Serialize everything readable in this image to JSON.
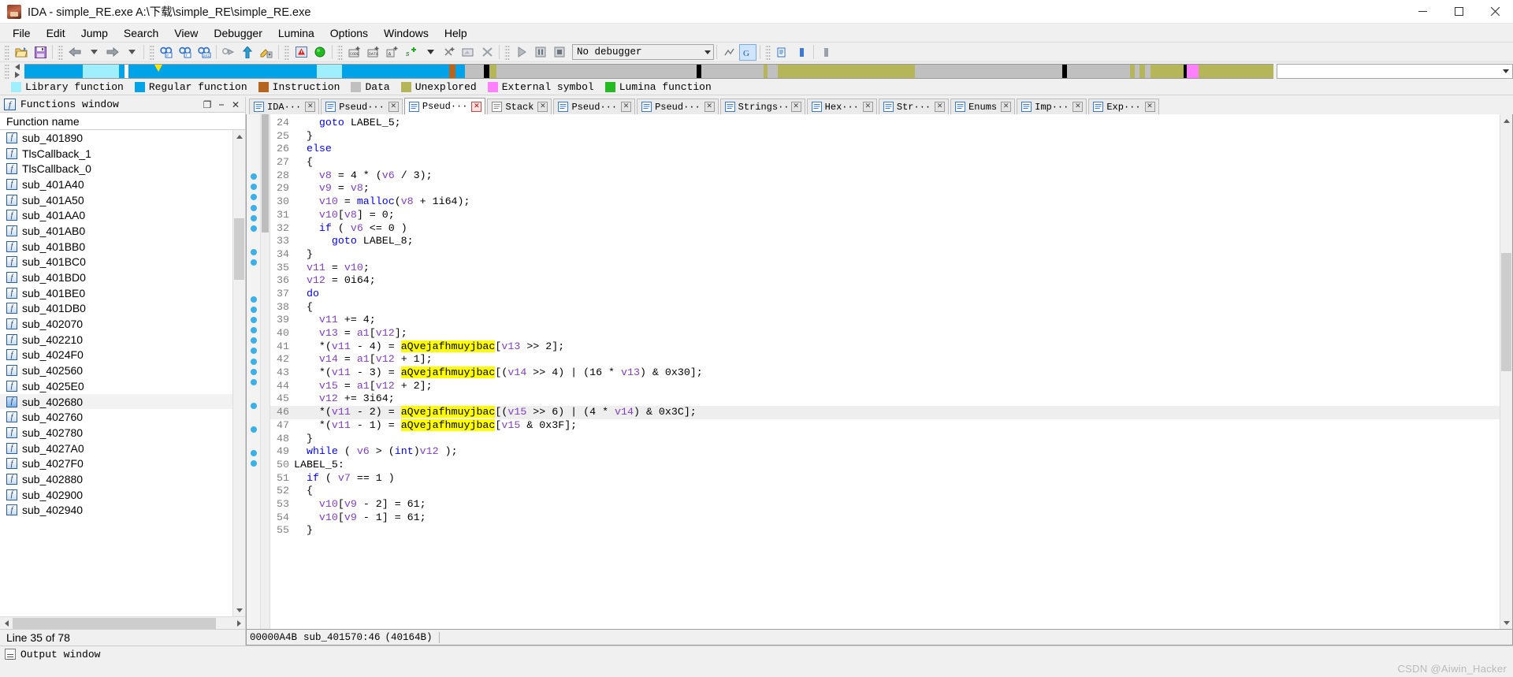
{
  "window": {
    "title": "IDA - simple_RE.exe A:\\下载\\simple_RE\\simple_RE.exe",
    "app_icon": "ida-logo-icon",
    "minimize_label": "–",
    "maximize_label": "☐",
    "close_label": "✕"
  },
  "menu": {
    "items": [
      {
        "label": "File"
      },
      {
        "label": "Edit"
      },
      {
        "label": "Jump"
      },
      {
        "label": "Search"
      },
      {
        "label": "View"
      },
      {
        "label": "Debugger"
      },
      {
        "label": "Lumina"
      },
      {
        "label": "Options"
      },
      {
        "label": "Windows"
      },
      {
        "label": "Help"
      }
    ]
  },
  "toolbar": {
    "debugger_combo_value": "No debugger",
    "buttons": [
      {
        "name": "open-file-icon"
      },
      {
        "name": "save-icon"
      },
      {
        "name": "back-arrow-icon"
      },
      {
        "name": "back-dropdown-icon"
      },
      {
        "name": "forward-arrow-icon"
      },
      {
        "name": "forward-dropdown-icon"
      },
      {
        "name": "search-hex-icon"
      },
      {
        "name": "search-text-icon"
      },
      {
        "name": "search-sequence-icon"
      },
      {
        "name": "jump-icon"
      },
      {
        "name": "up-arrow-icon"
      },
      {
        "name": "edit-function-icon"
      },
      {
        "name": "warning-icon"
      },
      {
        "name": "green-circle-icon"
      },
      {
        "name": "make-code-icon"
      },
      {
        "name": "make-data-icon"
      },
      {
        "name": "make-ascii-icon"
      },
      {
        "name": "make-struct-icon"
      },
      {
        "name": "make-struct-dropdown-icon"
      },
      {
        "name": "undefine-icon"
      },
      {
        "name": "rename-icon"
      },
      {
        "name": "delete-icon"
      },
      {
        "name": "run-icon"
      },
      {
        "name": "pause-icon"
      },
      {
        "name": "stop-icon"
      }
    ],
    "right_buttons": [
      {
        "name": "graph-overview-icon"
      },
      {
        "name": "lumina-icon"
      },
      {
        "name": "notepad-icon"
      },
      {
        "name": "hex-strip-icon"
      },
      {
        "name": "misc-icon"
      }
    ]
  },
  "navband": {
    "cursor_position_pct": 10.4,
    "segments": [
      {
        "color": "#00a2e8",
        "width_pct": 4.7
      },
      {
        "color": "#a0efff",
        "width_pct": 2.9
      },
      {
        "color": "#00a2e8",
        "width_pct": 0.4
      },
      {
        "color": "#ffffff",
        "width_pct": 0.3
      },
      {
        "color": "#00a2e8",
        "width_pct": 15.1
      },
      {
        "color": "#a0efff",
        "width_pct": 2.0
      },
      {
        "color": "#00a2e8",
        "width_pct": 8.6
      },
      {
        "color": "#b5651d",
        "width_pct": 0.5
      },
      {
        "color": "#00a2e8",
        "width_pct": 0.8
      },
      {
        "color": "#c0c0c0",
        "width_pct": 1.5
      },
      {
        "color": "#000000",
        "width_pct": 0.4
      },
      {
        "color": "#b5b55a",
        "width_pct": 0.6
      },
      {
        "color": "#c0c0c0",
        "width_pct": 16.0
      },
      {
        "color": "#000000",
        "width_pct": 0.4
      },
      {
        "color": "#c0c0c0",
        "width_pct": 5.0
      },
      {
        "color": "#b5b55a",
        "width_pct": 0.3
      },
      {
        "color": "#c0c0c0",
        "width_pct": 0.8
      },
      {
        "color": "#b5b55a",
        "width_pct": 11.0
      },
      {
        "color": "#c0c0c0",
        "width_pct": 11.8
      },
      {
        "color": "#000000",
        "width_pct": 0.4
      },
      {
        "color": "#c0c0c0",
        "width_pct": 5.0
      },
      {
        "color": "#b5b55a",
        "width_pct": 0.4
      },
      {
        "color": "#c0c0c0",
        "width_pct": 0.4
      },
      {
        "color": "#b5b55a",
        "width_pct": 0.4
      },
      {
        "color": "#c0c0c0",
        "width_pct": 0.5
      },
      {
        "color": "#b5b55a",
        "width_pct": 2.6
      },
      {
        "color": "#000000",
        "width_pct": 0.3
      },
      {
        "color": "#ff80ff",
        "width_pct": 0.9
      },
      {
        "color": "#b5b55a",
        "width_pct": 6.3
      },
      {
        "color": "#000000",
        "width_pct": 0.3
      },
      {
        "color": "#b5b55a",
        "width_pct": 6.2
      },
      {
        "color": "#000000",
        "width_pct": 16.0
      }
    ]
  },
  "legend": {
    "items": [
      {
        "label": "Library function",
        "color": "#a0efff"
      },
      {
        "label": "Regular function",
        "color": "#00a2e8"
      },
      {
        "label": "Instruction",
        "color": "#b5651d"
      },
      {
        "label": "Data",
        "color": "#c0c0c0"
      },
      {
        "label": "Unexplored",
        "color": "#b5b55a"
      },
      {
        "label": "External symbol",
        "color": "#ff80ff"
      },
      {
        "label": "Lumina function",
        "color": "#22bb22"
      }
    ]
  },
  "functions_window": {
    "title": "Functions window",
    "icon": "function-window-icon",
    "controls": [
      {
        "name": "restore-icon",
        "glyph": "❐"
      },
      {
        "name": "minimize-icon",
        "glyph": "⎯"
      },
      {
        "name": "close-icon",
        "glyph": "✕"
      }
    ],
    "column_header": "Function name",
    "rows": [
      {
        "name": "sub_401890"
      },
      {
        "name": "TlsCallback_1"
      },
      {
        "name": "TlsCallback_0"
      },
      {
        "name": "sub_401A40"
      },
      {
        "name": "sub_401A50"
      },
      {
        "name": "sub_401AA0"
      },
      {
        "name": "sub_401AB0"
      },
      {
        "name": "sub_401BB0"
      },
      {
        "name": "sub_401BC0"
      },
      {
        "name": "sub_401BD0"
      },
      {
        "name": "sub_401BE0"
      },
      {
        "name": "sub_401DB0"
      },
      {
        "name": "sub_402070"
      },
      {
        "name": "sub_402210"
      },
      {
        "name": "sub_4024F0"
      },
      {
        "name": "sub_402560"
      },
      {
        "name": "sub_4025E0"
      },
      {
        "name": "sub_402680",
        "selected": true
      },
      {
        "name": "sub_402760"
      },
      {
        "name": "sub_402780"
      },
      {
        "name": "sub_4027A0"
      },
      {
        "name": "sub_4027F0"
      },
      {
        "name": "sub_402880"
      },
      {
        "name": "sub_402900"
      },
      {
        "name": "sub_402940"
      }
    ],
    "status": "Line 35 of 78"
  },
  "tabs": [
    {
      "label": "IDA···",
      "icon": "ida-view-icon",
      "icon_color": "#3a7ad6",
      "active": false,
      "close": "✕"
    },
    {
      "label": "Pseud···",
      "icon": "pseudocode-icon",
      "icon_color": "#3a7ad6",
      "active": false,
      "close": "✕"
    },
    {
      "label": "Pseud···",
      "icon": "pseudocode-icon",
      "icon_color": "#3a7ad6",
      "active": true,
      "close": "✕"
    },
    {
      "label": "Stack",
      "icon": "stack-icon",
      "icon_color": "#888888",
      "active": false,
      "close": "✕"
    },
    {
      "label": "Pseud···",
      "icon": "pseudocode-icon",
      "icon_color": "#3a7ad6",
      "active": false,
      "close": "✕"
    },
    {
      "label": "Pseud···",
      "icon": "pseudocode-icon",
      "icon_color": "#3a7ad6",
      "active": false,
      "close": "✕"
    },
    {
      "label": "Strings···",
      "icon": "strings-icon",
      "icon_color": "#3a7ad6",
      "active": false,
      "close": "✕"
    },
    {
      "label": "Hex···",
      "icon": "hex-view-icon",
      "icon_color": "#3a7ad6",
      "active": false,
      "close": "✕"
    },
    {
      "label": "Str···",
      "icon": "structures-icon",
      "icon_color": "#3a7ad6",
      "active": false,
      "close": "✕"
    },
    {
      "label": "Enums",
      "icon": "enums-icon",
      "icon_color": "#3a7ad6",
      "active": false,
      "close": "✕"
    },
    {
      "label": "Imp···",
      "icon": "imports-icon",
      "icon_color": "#3a7ad6",
      "active": false,
      "close": "✕"
    },
    {
      "label": "Exp···",
      "icon": "exports-icon",
      "icon_color": "#3a7ad6",
      "active": false,
      "close": "✕"
    }
  ],
  "code": {
    "highlighted_identifier": "aQvejafhmuyjbac",
    "current_line": 46,
    "lines": [
      {
        "n": 24,
        "bm": false,
        "indent": 4,
        "html": "<span class=\"kw\">goto</span> <span class=\"ctext\">LABEL_5;</span>"
      },
      {
        "n": 25,
        "bm": false,
        "indent": 2,
        "html": "<span class=\"ctext\">}</span>"
      },
      {
        "n": 26,
        "bm": false,
        "indent": 2,
        "html": "<span class=\"kw\">else</span>"
      },
      {
        "n": 27,
        "bm": false,
        "indent": 2,
        "html": "<span class=\"ctext\">{</span>"
      },
      {
        "n": 28,
        "bm": true,
        "indent": 4,
        "html": "<span class=\"var\">v8</span> <span class=\"ctext\">= 4 * (</span><span class=\"var\">v6</span> <span class=\"ctext\">/ 3);</span>"
      },
      {
        "n": 29,
        "bm": true,
        "indent": 4,
        "html": "<span class=\"var\">v9</span> <span class=\"ctext\">= </span><span class=\"var\">v8</span><span class=\"ctext\">;</span>"
      },
      {
        "n": 30,
        "bm": true,
        "indent": 4,
        "html": "<span class=\"var\">v10</span> <span class=\"ctext\">= </span><span class=\"fn\">malloc</span><span class=\"ctext\">(</span><span class=\"var\">v8</span> <span class=\"ctext\">+ 1i64);</span>"
      },
      {
        "n": 31,
        "bm": true,
        "indent": 4,
        "html": "<span class=\"var\">v10</span><span class=\"ctext\">[</span><span class=\"var\">v8</span><span class=\"ctext\">] = 0;</span>"
      },
      {
        "n": 32,
        "bm": true,
        "indent": 4,
        "html": "<span class=\"kw\">if</span> <span class=\"ctext\">( </span><span class=\"var\">v6</span> <span class=\"ctext\">&lt;= 0 )</span>"
      },
      {
        "n": 33,
        "bm": true,
        "indent": 6,
        "html": "<span class=\"kw\">goto</span> <span class=\"ctext\">LABEL_8;</span>"
      },
      {
        "n": 34,
        "bm": false,
        "indent": 2,
        "html": "<span class=\"ctext\">}</span>"
      },
      {
        "n": 35,
        "bm": true,
        "indent": 2,
        "html": "<span class=\"var\">v11</span> <span class=\"ctext\">= </span><span class=\"var\">v10</span><span class=\"ctext\">;</span>"
      },
      {
        "n": 36,
        "bm": true,
        "indent": 2,
        "html": "<span class=\"var\">v12</span> <span class=\"ctext\">= 0i64;</span>"
      },
      {
        "n": 37,
        "bm": false,
        "indent": 2,
        "html": "<span class=\"kw\">do</span>"
      },
      {
        "n": 38,
        "bm": false,
        "indent": 2,
        "html": "<span class=\"ctext\">{</span>"
      },
      {
        "n": 39,
        "bm": true,
        "indent": 4,
        "html": "<span class=\"var\">v11</span> <span class=\"ctext\">+= 4;</span>"
      },
      {
        "n": 40,
        "bm": true,
        "indent": 4,
        "html": "<span class=\"var\">v13</span> <span class=\"ctext\">= </span><span class=\"var\">a1</span><span class=\"ctext\">[</span><span class=\"var\">v12</span><span class=\"ctext\">];</span>"
      },
      {
        "n": 41,
        "bm": true,
        "indent": 4,
        "html": "<span class=\"ctext\">*(</span><span class=\"var\">v11</span> <span class=\"ctext\">- 4) = </span><span class=\"hlstr\">aQvejafhmuyjbac</span><span class=\"ctext\">[</span><span class=\"var\">v13</span> <span class=\"ctext\">&gt;&gt; 2];</span>"
      },
      {
        "n": 42,
        "bm": true,
        "indent": 4,
        "html": "<span class=\"var\">v14</span> <span class=\"ctext\">= </span><span class=\"var\">a1</span><span class=\"ctext\">[</span><span class=\"var\">v12</span> <span class=\"ctext\">+ 1];</span>"
      },
      {
        "n": 43,
        "bm": true,
        "indent": 4,
        "html": "<span class=\"ctext\">*(</span><span class=\"var\">v11</span> <span class=\"ctext\">- 3) = </span><span class=\"hlstr\">aQvejafhmuyjbac</span><span class=\"ctext\">[(</span><span class=\"var\">v14</span> <span class=\"ctext\">&gt;&gt; 4) | (16 * </span><span class=\"var\">v13</span><span class=\"ctext\">) &amp; 0x30];</span>"
      },
      {
        "n": 44,
        "bm": true,
        "indent": 4,
        "html": "<span class=\"var\">v15</span> <span class=\"ctext\">= </span><span class=\"var\">a1</span><span class=\"ctext\">[</span><span class=\"var\">v12</span> <span class=\"ctext\">+ 2];</span>"
      },
      {
        "n": 45,
        "bm": true,
        "indent": 4,
        "html": "<span class=\"var\">v12</span> <span class=\"ctext\">+= 3i64;</span>"
      },
      {
        "n": 46,
        "bm": true,
        "indent": 4,
        "hl": true,
        "html": "<span class=\"ctext\">*(</span><span class=\"var\">v11</span> <span class=\"ctext\">- 2) = </span><span class=\"hlstr\">aQvejafhmuyjbac</span><span class=\"ctext\">[(</span><span class=\"var\">v15</span> <span class=\"ctext\">&gt;&gt; 6) | (4 * </span><span class=\"var\">v14</span><span class=\"ctext\">) &amp; 0x3C];</span>"
      },
      {
        "n": 47,
        "bm": true,
        "indent": 4,
        "html": "<span class=\"ctext\">*(</span><span class=\"var\">v11</span> <span class=\"ctext\">- 1) = </span><span class=\"hlstr\">aQvejafhmuyjbac</span><span class=\"ctext\">[</span><span class=\"var\">v15</span> <span class=\"ctext\">&amp; 0x3F];</span>"
      },
      {
        "n": 48,
        "bm": false,
        "indent": 2,
        "html": "<span class=\"ctext\">}</span>"
      },
      {
        "n": 49,
        "bm": true,
        "indent": 2,
        "html": "<span class=\"kw\">while</span> <span class=\"ctext\">( </span><span class=\"var\">v6</span> <span class=\"ctext\">&gt; (</span><span class=\"kw\">int</span><span class=\"ctext\">)</span><span class=\"var\">v12</span> <span class=\"ctext\">);</span>"
      },
      {
        "n": 50,
        "bm": false,
        "indent": 0,
        "html": "<span class=\"ctext\">LABEL_5:</span>"
      },
      {
        "n": 51,
        "bm": true,
        "indent": 2,
        "html": "<span class=\"kw\">if</span> <span class=\"ctext\">( </span><span class=\"var\">v7</span> <span class=\"ctext\">== 1 )</span>"
      },
      {
        "n": 52,
        "bm": false,
        "indent": 2,
        "html": "<span class=\"ctext\">{</span>"
      },
      {
        "n": 53,
        "bm": true,
        "indent": 4,
        "html": "<span class=\"var\">v10</span><span class=\"ctext\">[</span><span class=\"var\">v9</span> <span class=\"ctext\">- 2] = 61;</span>"
      },
      {
        "n": 54,
        "bm": true,
        "indent": 4,
        "html": "<span class=\"var\">v10</span><span class=\"ctext\">[</span><span class=\"var\">v9</span> <span class=\"ctext\">- 1] = 61;</span>"
      },
      {
        "n": 55,
        "bm": false,
        "indent": 2,
        "html": "<span class=\"ctext\">}</span>"
      }
    ],
    "status_address": "00000A4B",
    "status_location": "sub_401570:46",
    "status_offset": "(40164B)"
  },
  "output_window": {
    "title": "Output window",
    "icon": "output-window-icon"
  },
  "watermark": "CSDN @Aiwin_Hacker"
}
